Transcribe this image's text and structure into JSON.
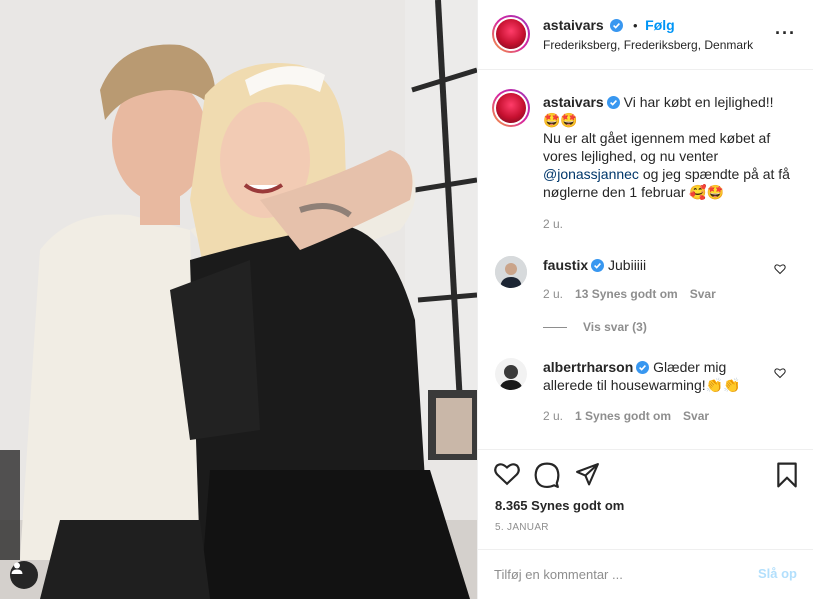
{
  "post": {
    "username": "astaivars",
    "follow_dot": "•",
    "follow_label": "Følg",
    "location": "Frederiksberg, Frederiksberg, Denmark",
    "more_icon": "more-horizontal-icon"
  },
  "caption": {
    "username": "astaivars",
    "line1": "Vi har købt en lejlighed!!",
    "emoji1": "🤩🤩",
    "line2": "Nu er alt gået igennem med købet af vores lejlighed, og nu venter",
    "mention": "@jonassjannec",
    "line3": "og jeg spændte på at få nøglerne den 1 februar",
    "emoji2": "🥰🤩",
    "time": "2 u."
  },
  "comments": [
    {
      "username": "faustix",
      "text": "Jubiiiii",
      "time": "2 u.",
      "likes": "13 Synes godt om",
      "reply": "Svar",
      "view_replies": "Vis svar (3)"
    },
    {
      "username": "albertrharson",
      "text": "Glæder mig allerede til housewarming!",
      "emoji": "👏👏",
      "time": "2 u.",
      "likes": "1 Synes godt om",
      "reply": "Svar"
    }
  ],
  "footer": {
    "likes": "8.365 Synes godt om",
    "date": "5. JANUAR",
    "comment_placeholder": "Tilføj en kommentar ...",
    "post_label": "Slå op"
  },
  "colors": {
    "accent": "#0095f6",
    "post_disabled": "#b2dffc",
    "muted": "#8e8e8e",
    "text": "#262626"
  }
}
